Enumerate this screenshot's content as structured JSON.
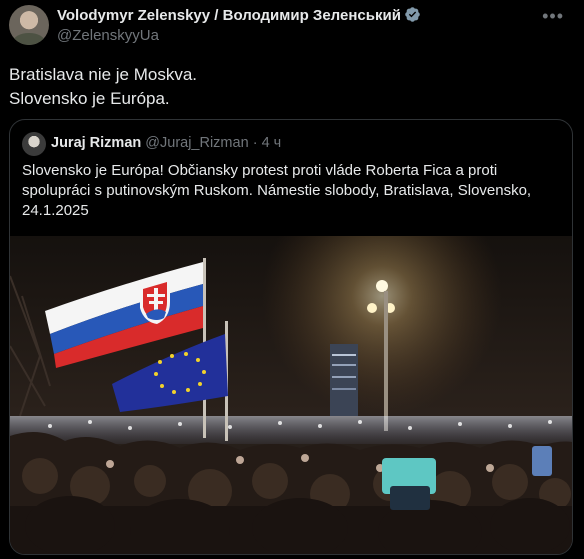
{
  "author": {
    "name": "Volodymyr Zelenskyy / Володимир Зеленський",
    "handle": "@ZelenskyyUa"
  },
  "post": {
    "lines": [
      "Bratislava nie je Moskva.",
      "Slovensko je Európa."
    ]
  },
  "quoted": {
    "name": "Juraj Rizman",
    "handle": "@Juraj_Rizman",
    "separator": "·",
    "time": "4 ч",
    "lines": [
      "Slovensko je Európa! Občiansky protest proti vláde Roberta Fica a proti",
      "spolupráci s putinovským Ruskom. Námestie slobody, Bratislava, Slovensko,",
      "24.1.2025"
    ]
  },
  "icons": {
    "verified": "verified-badge-icon",
    "more": "more-options-icon"
  },
  "colors": {
    "background": "#000000",
    "text": "#e7e9ea",
    "secondary": "#71767b",
    "border": "#2f3336",
    "verified": "#829aab"
  }
}
